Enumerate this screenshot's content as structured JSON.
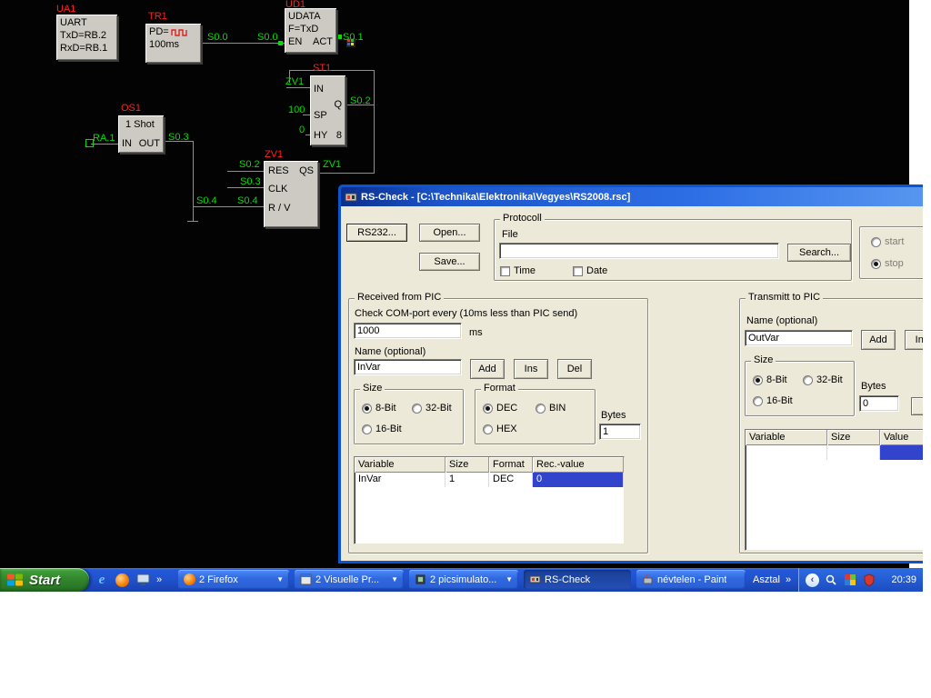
{
  "diagram": {
    "blocks": {
      "ua1": {
        "name": "UA1",
        "l1": "UART",
        "l2": "TxD=RB.2",
        "l3": "RxD=RB.1"
      },
      "tr1": {
        "name": "TR1",
        "l1": "PD=",
        "l2": "100ms"
      },
      "ud1": {
        "name": "UD1",
        "l1": "UDATA",
        "l2": "F=TxD",
        "en": "EN",
        "act": "ACT"
      },
      "st1": {
        "name": "ST1",
        "pin_in": "IN",
        "pin_sp": "SP",
        "pin_hy": "HY",
        "pin_q": "Q",
        "pin_8": "8"
      },
      "os1": {
        "name": "OS1",
        "l1": "1 Shot",
        "pin_in": "IN",
        "pin_out": "OUT"
      },
      "zv1": {
        "name": "ZV1",
        "pin_res": "RES",
        "pin_qs": "QS",
        "pin_clk": "CLK",
        "pin_rv": "R / V"
      }
    },
    "signals": [
      "S0.0",
      "S0.0",
      "S0.1",
      "ZV1",
      "100",
      "0",
      "S0.2",
      "RA.1",
      "S0.3",
      "S0.2",
      "S0.3",
      "S0.4",
      "S0.4",
      "ZV1"
    ]
  },
  "dialog": {
    "title": "RS-Check - [C:\\Technika\\Elektronika\\Vegyes\\RS2008.rsc]",
    "rs232": "RS232...",
    "open": "Open...",
    "save": "Save...",
    "protocol": {
      "legend": "Protocoll",
      "file_label": "File",
      "file_value": "",
      "search": "Search...",
      "time": "Time",
      "date": "Date"
    },
    "run": {
      "start": "start",
      "stop": "stop"
    },
    "received": {
      "legend": "Received from PIC",
      "interval_label": "Check COM-port every (10ms less than PIC send)",
      "interval_value": "1000",
      "interval_unit": "ms",
      "name_label": "Name (optional)",
      "name_value": "InVar",
      "add": "Add",
      "ins": "Ins",
      "del": "Del",
      "size_legend": "Size",
      "size_8": "8-Bit",
      "size_32": "32-Bit",
      "size_16": "16-Bit",
      "format_legend": "Format",
      "format_dec": "DEC",
      "format_bin": "BIN",
      "format_hex": "HEX",
      "bytes_label": "Bytes",
      "bytes_value": "1",
      "table": {
        "h": [
          "Variable",
          "Size",
          "Format",
          "Rec.-value"
        ],
        "row": [
          "InVar",
          "1",
          "DEC",
          "0"
        ]
      }
    },
    "transmit": {
      "legend": "Transmitt to PIC",
      "name_label": "Name (optional)",
      "name_value": "OutVar",
      "add": "Add",
      "ins": "Ins",
      "size_legend": "Size",
      "size_8": "8-Bit",
      "size_32": "32-Bit",
      "size_16": "16-Bit",
      "bytes_label": "Bytes",
      "bytes_value": "0",
      "table": {
        "h": [
          "Variable",
          "Size",
          "Value"
        ]
      }
    }
  },
  "taskbar": {
    "start": "Start",
    "tasks": [
      {
        "label": "2 Firefox"
      },
      {
        "label": "2 Visuelle Pr..."
      },
      {
        "label": "2 picsimulato..."
      },
      {
        "label": "RS-Check"
      },
      {
        "label": "névtelen - Paint"
      }
    ],
    "desktop": "Asztal",
    "chevron": "»",
    "clock": "20:39"
  }
}
